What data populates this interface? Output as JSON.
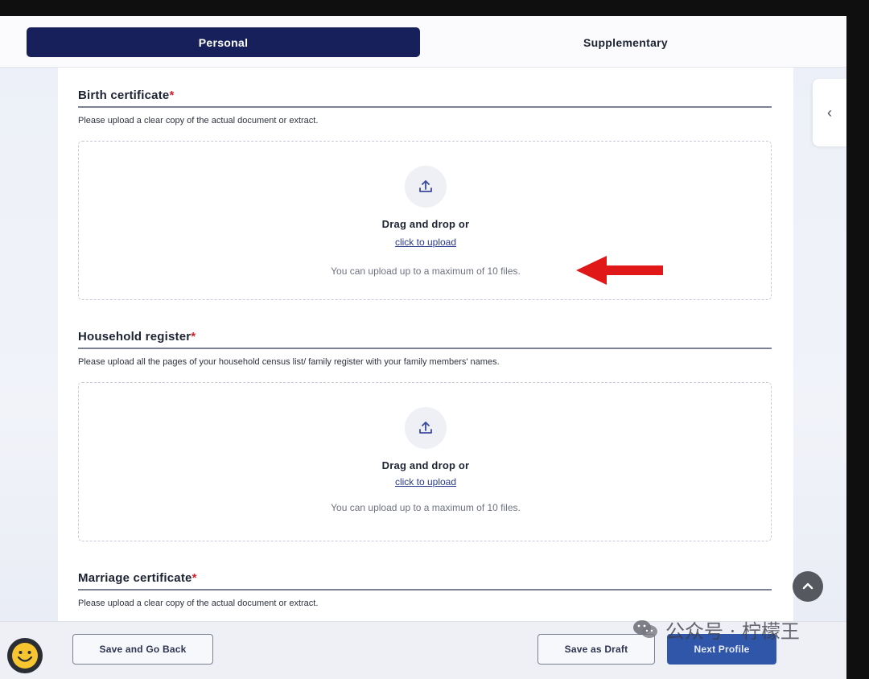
{
  "tabs": [
    {
      "label": "Personal",
      "active": true
    },
    {
      "label": "Supplementary",
      "active": false
    }
  ],
  "sections": [
    {
      "title": "Birth certificate",
      "required_mark": "*",
      "description": "Please upload a clear copy of the actual document or extract.",
      "dropzone": {
        "main_text": "Drag and drop or",
        "link_text": "click to upload",
        "note": "You can upload up to a maximum of 10 files."
      }
    },
    {
      "title": "Household register",
      "required_mark": "*",
      "description": "Please upload all the pages of your household census list/ family register with your family members' names.",
      "dropzone": {
        "main_text": "Drag and drop or",
        "link_text": "click to upload",
        "note": "You can upload up to a maximum of 10 files."
      }
    },
    {
      "title": "Marriage certificate",
      "required_mark": "*",
      "description": "Please upload a clear copy of the actual document or extract."
    }
  ],
  "footer": {
    "back_label": "Save and Go Back",
    "draft_label": "Save as Draft",
    "next_label": "Next Profile"
  },
  "watermark": {
    "text": "公众号 · 柠檬王"
  },
  "icons": {
    "side_toggle": "chevron-left-icon",
    "upload": "upload-icon",
    "scroll_top": "chevron-up-icon",
    "annotation": "red-arrow-icon",
    "emoji": "smiley-icon"
  },
  "colors": {
    "tab_active_bg": "#17205a",
    "required": "#d21f2b",
    "link": "#2a3a8c",
    "primary_button": "#2f56a8",
    "annotation_arrow": "#e01818"
  }
}
